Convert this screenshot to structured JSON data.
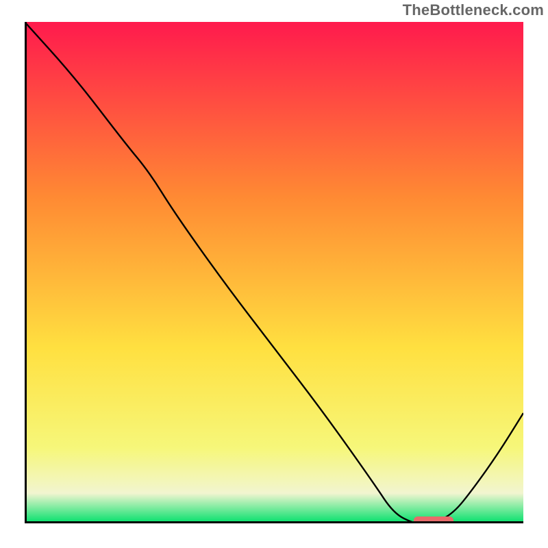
{
  "watermark": "TheBottleneck.com",
  "colors": {
    "gradient_top": "#ff1a4d",
    "gradient_mid_orange": "#ff8a33",
    "gradient_mid_yellow": "#ffe040",
    "gradient_lower_yellow": "#f6f77a",
    "gradient_pale": "#f2f5d0",
    "gradient_green": "#00e06a",
    "axis": "#000000",
    "curve": "#000000",
    "marker": "#e86a6a"
  },
  "chart_data": {
    "type": "line",
    "title": "",
    "xlabel": "",
    "ylabel": "",
    "xlim": [
      0,
      100
    ],
    "ylim": [
      0,
      100
    ],
    "x": [
      0,
      10,
      20,
      25,
      30,
      40,
      50,
      60,
      70,
      74,
      78,
      80,
      82,
      86,
      90,
      95,
      100
    ],
    "values": [
      100,
      89,
      76,
      70,
      62,
      48,
      35,
      22,
      8,
      2,
      0,
      0,
      0,
      2,
      7,
      14,
      22
    ],
    "marker": {
      "x_start": 78,
      "x_end": 86,
      "y": 0
    }
  }
}
